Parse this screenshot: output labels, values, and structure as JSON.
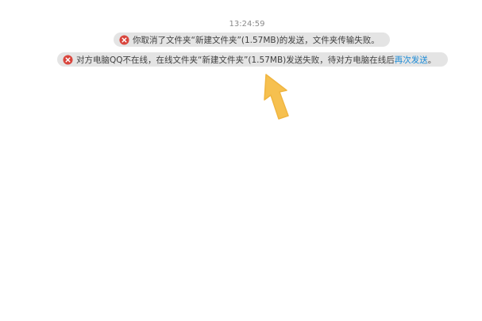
{
  "chat": {
    "timestamp": "13:24:59",
    "messages": [
      {
        "icon": "error-circle-icon",
        "text": "你取消了文件夹“新建文件夹”(1.57MB)的发送，文件夹传输失败。"
      },
      {
        "icon": "error-circle-icon",
        "text": "对方电脑QQ不在线，在线文件夹“新建文件夹”(1.57MB)发送失败，待对方电脑在线后",
        "link": "再次发送",
        "suffix": "。"
      }
    ]
  },
  "colors": {
    "error_red": "#d9453c",
    "link_blue": "#1a8ad6",
    "notice_bg": "#e4e4e4",
    "arrow_yellow": "#f6c04f"
  }
}
